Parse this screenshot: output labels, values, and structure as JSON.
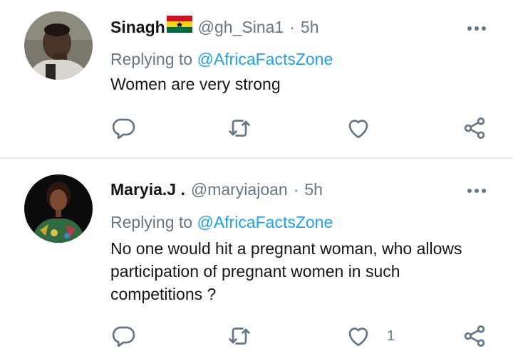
{
  "tweets": [
    {
      "name": "Sinagh",
      "flag": "ghana-flag",
      "handle": "@gh_Sina1",
      "separator": "·",
      "time": "5h",
      "replying_label": "Replying to",
      "replying_to": "@AfricaFactsZone",
      "text": "Women are very strong",
      "like_count": ""
    },
    {
      "name": "Maryia.J .",
      "handle": "@maryiajoan",
      "separator": "·",
      "time": "5h",
      "replying_label": "Replying to",
      "replying_to": "@AfricaFactsZone",
      "text": "No one would hit a pregnant woman, who allows participation of pregnant women in such competitions ?",
      "like_count": "1"
    }
  ],
  "icons": [
    "reply-icon",
    "retweet-icon",
    "like-icon",
    "share-icon",
    "more-options-icon"
  ],
  "colors": {
    "text": "#14171a",
    "secondary": "#657786",
    "mention": "#1da1f2",
    "divider": "#e6ecf0"
  }
}
